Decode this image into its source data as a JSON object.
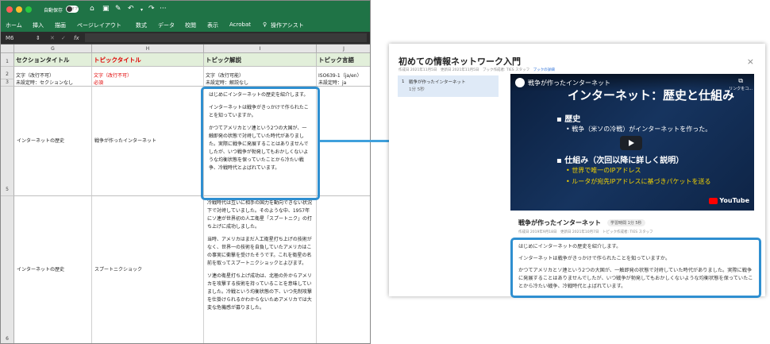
{
  "excel": {
    "autosave_label": "自動保存",
    "autosave_state": "オフ",
    "more": "···",
    "ribbon_tabs": [
      "ホーム",
      "挿入",
      "描画",
      "ページレイアウト",
      "数式",
      "データ",
      "校閲",
      "表示",
      "Acrobat"
    ],
    "ribbon_assist": "操作アシスト",
    "cell_ref": "M6",
    "fx": "fx",
    "columns": [
      "G",
      "H",
      "I",
      "J"
    ],
    "rows": [
      "1",
      "2",
      "3",
      "5",
      "6"
    ],
    "headers": [
      "セクションタイトル",
      "トピックタイトル",
      "トピック解説",
      "トピック言語"
    ],
    "meta": {
      "g2": "文字（改行不可）",
      "g3": "未設定時：セクションなし",
      "h2": "文字（改行不可）",
      "h3": "必須",
      "i2": "文字（改行可能）",
      "i3": "未設定時：解説なし",
      "j2": "ISO639-1（ja/en）",
      "j3": "未設定時：ja"
    },
    "row5": {
      "section": "インターネットの歴史",
      "topic": "戦争が作ったインターネット",
      "desc": [
        "はじめにインターネットの歴史を紹介します。",
        "インターネットは戦争がきっかけで作られたことを知っていますか。",
        "かつてアメリカとソ連という2つの大国が、一触即発の状態で対峙していた時代がありました。実際に戦争に発展することはありませんでしたが、いつ戦争が勃発してもおかしくないような均衡状態を保っていたことから冷たい戦争、冷戦時代とよばれています。"
      ]
    },
    "row6": {
      "section": "インターネットの歴史",
      "topic": "スプートニクショック",
      "desc": [
        "冷戦時代は互いに相手の国力を動向できない状況下で対峙していました。そのような中、1957年にソ連が世界初の人工衛星「スプートニク」の打ち上げに成功しました。",
        "当時、アメリカはまだ人工衛星打ち上げの技術がなく、世界一の技術を自負していたアメリカはこの事実に衝撃を受けたそうです。これを衛星の名前を取ってスプートニクショックとよびます。",
        "ソ連の衛星打ち上げ成功は、北極の外からアメリカを攻撃する技術を持っていることを意味していました。冷戦という均衡状態の下、いつ先制攻撃を仕掛けられるかわからないためアメリカでは大変な危機感が募りました。"
      ]
    }
  },
  "web": {
    "title": "初めての情報ネットワーク入門",
    "meta": "作成日 2021年11月5日　更新日 2021年11月5日　ブック作成者: TIES スタッフ",
    "meta_link": "ブックの詳細",
    "close": "×",
    "list_index": "1",
    "list_title": "戦争が作ったインターネット",
    "list_time": "1分 5秒",
    "video": {
      "channel_title": "戦争が作ったインターネット",
      "copy_link": "リンクをコ...",
      "slide_title": "インターネット：歴史と仕組み",
      "b1": "歴史",
      "b1a": "戦争（米ソの冷戦）がインターネットを作った。",
      "b2": "仕組み（次回以降に詳しく説明）",
      "b2a": "世界で唯一のIPアドレス",
      "b2b": "ルータが宛先IPアドレスに基づきパケットを送る",
      "youtube": "YouTube"
    },
    "topic_title": "戦争が作ったインターネット",
    "badge": "学習時間 1分 5秒",
    "topic_meta": "作成日 2019年9月18日　更新日 2021年10月7日　トピック作成者: TIES スタッフ",
    "desc": [
      "はじめにインターネットの歴史を紹介します。",
      "インターネットは戦争がきっかけで作られたことを知っていますか。",
      "かつてアメリカとソ連という2つの大国が、一触即発の状態で対峙していた時代がありました。実際に戦争に発展することはありませんでしたが、いつ戦争が勃発してもおかしくないような均衡状態を保っていたことから冷たい戦争、冷戦時代とよばれています。"
    ]
  },
  "colors": {
    "excel_green": "#1f7346",
    "highlight": "#2f8fd0",
    "header_fill": "#e2efda",
    "required_red": "#e00000"
  }
}
